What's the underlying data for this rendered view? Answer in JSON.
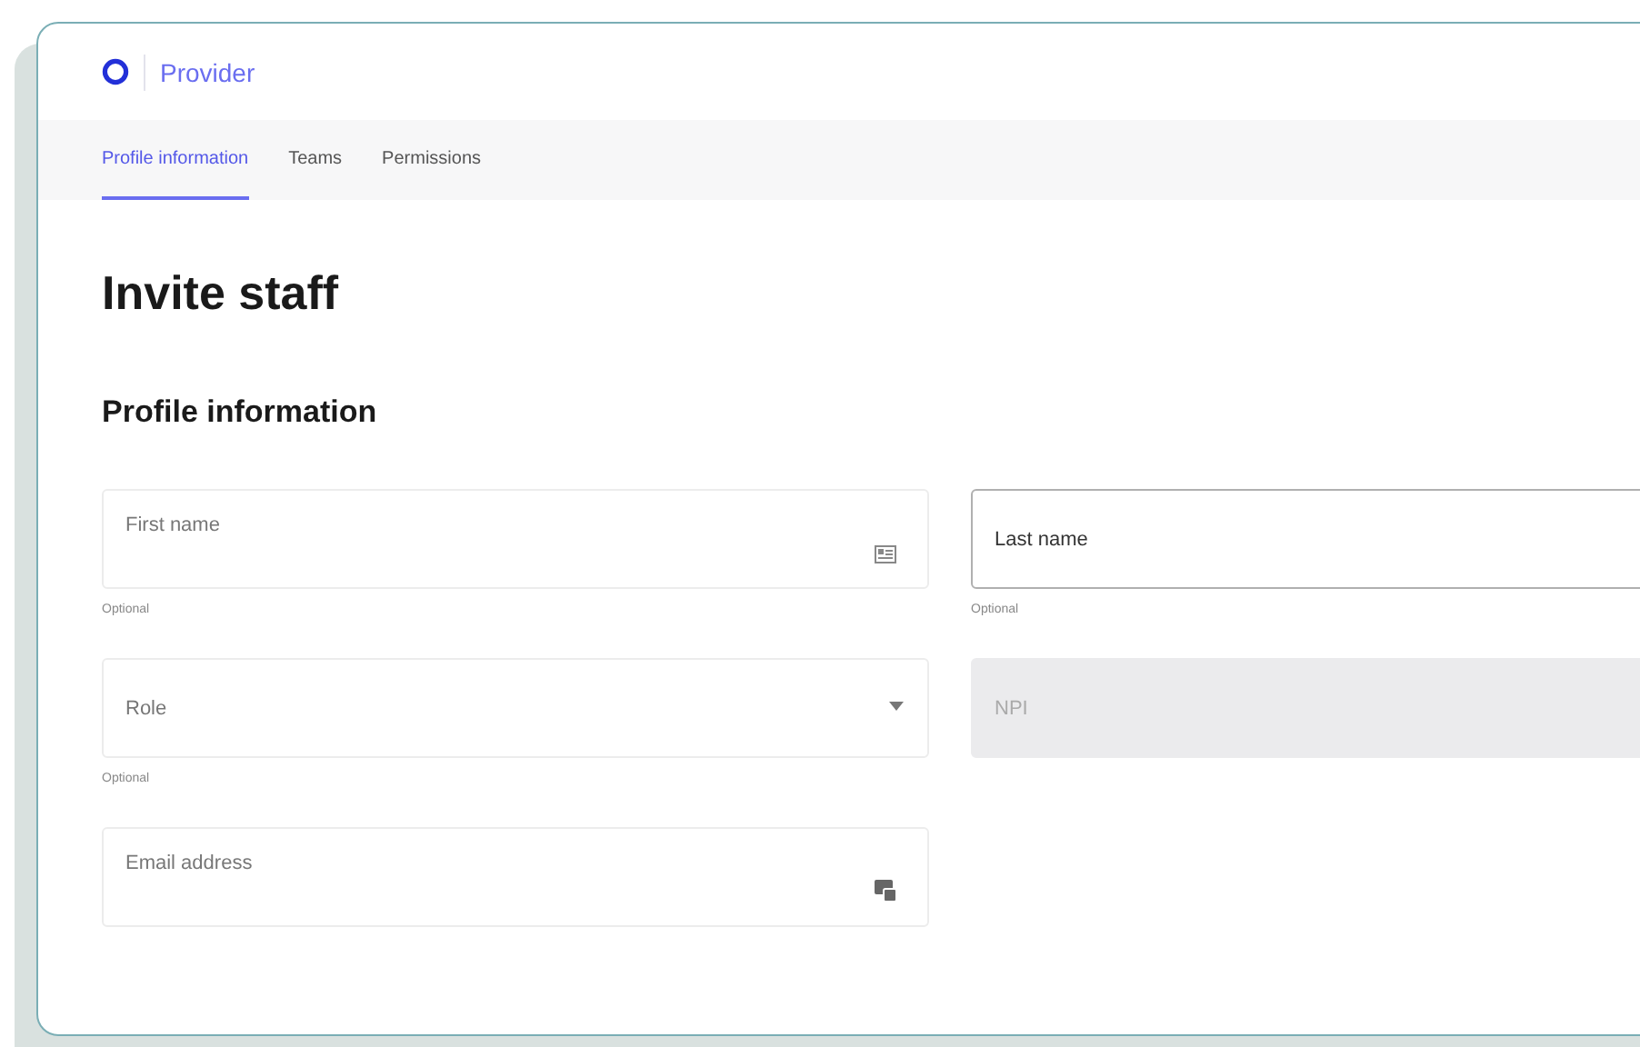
{
  "header": {
    "brand": "Provider"
  },
  "tabs": [
    {
      "label": "Profile information",
      "selected": true
    },
    {
      "label": "Teams",
      "selected": false
    },
    {
      "label": "Permissions",
      "selected": false
    }
  ],
  "title": "Invite staff",
  "section": {
    "title": "Profile information"
  },
  "fields": [
    {
      "kind": "contact",
      "placeholder": "First name",
      "focused": false,
      "disabled": false,
      "helper": "Optional"
    },
    {
      "kind": "text",
      "placeholder": "Last name",
      "focused": true,
      "disabled": false,
      "helper": "Optional"
    },
    {
      "kind": "select",
      "placeholder": "Role",
      "focused": false,
      "disabled": false,
      "helper": "Optional"
    },
    {
      "kind": "text",
      "placeholder": "NPI",
      "focused": false,
      "disabled": true
    },
    {
      "kind": "email",
      "placeholder": "Email address",
      "focused": false,
      "disabled": false
    }
  ]
}
